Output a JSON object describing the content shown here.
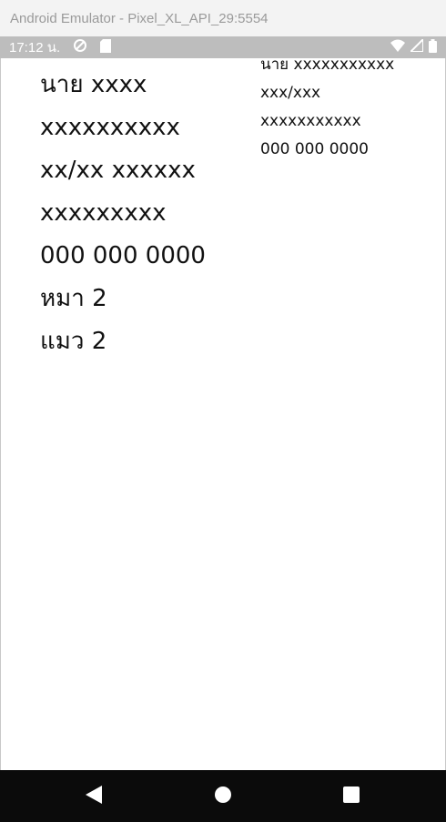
{
  "window": {
    "title": "Android Emulator - Pixel_XL_API_29:5554"
  },
  "status_bar": {
    "time": "17:12 น.",
    "icons": [
      "data-saver-icon",
      "sd-card-icon",
      "wifi-icon",
      "signal-icon",
      "battery-icon"
    ]
  },
  "main": {
    "left_lines": [
      "นาย xxxx",
      "xxxxxxxxxx",
      "xx/xx xxxxxx",
      "xxxxxxxxx",
      "000 000 0000",
      "หมา 2",
      "แมว 2"
    ],
    "right_lines": [
      "นาย xxxxxxxxxxx",
      "xxx/xxx",
      "xxxxxxxxxxx",
      "000 000 0000"
    ]
  },
  "nav_bar": {
    "buttons": [
      "back-icon",
      "home-icon",
      "recents-icon"
    ]
  },
  "colors": {
    "status_bar": "#bdbdbd",
    "nav_bar": "#0b0b0b",
    "title_bar": "#f3f3f3"
  }
}
